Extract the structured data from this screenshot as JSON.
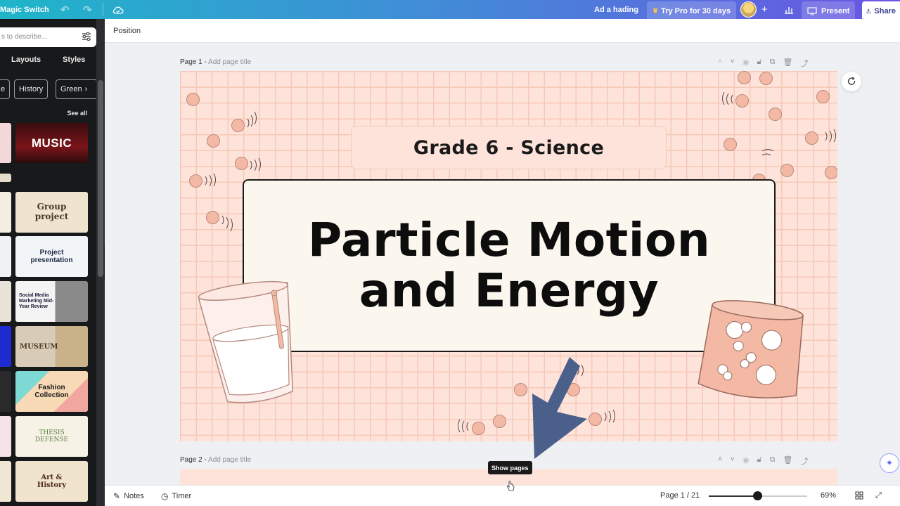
{
  "topbar": {
    "brand": "Magic Switch",
    "add_heading": "Ad a hading",
    "try_pro": "Try Pro for 30 days",
    "present": "Present",
    "share": "Share"
  },
  "left_panel": {
    "search_placeholder": "s to describe...",
    "tabs": [
      "Layouts",
      "Styles"
    ],
    "chips": [
      "e",
      "History",
      "Green"
    ],
    "see_all": "See all",
    "templates": [
      {
        "label": "MUSIC"
      },
      {
        "label": "Group project"
      },
      {
        "label": "Project presentation"
      },
      {
        "label": "Social Media Marketing Mid-Year Review"
      },
      {
        "label": "MUSEUM"
      },
      {
        "label": "Fashion Collection"
      },
      {
        "label": "THESIS DEFENSE"
      },
      {
        "label": "Art & History"
      }
    ]
  },
  "context_bar": {
    "position": "Position"
  },
  "page1": {
    "label": "Page 1 - ",
    "subtitle": "Add page title"
  },
  "page2": {
    "label": "Page 2 - ",
    "subtitle": "Add page title"
  },
  "slide": {
    "grade": "Grade 6 - Science",
    "title_line1": "Particle Motion",
    "title_line2": "and Energy"
  },
  "tooltip": "Show pages",
  "bottombar": {
    "notes": "Notes",
    "timer": "Timer",
    "page_count": "Page 1 / 21",
    "zoom": "69%"
  },
  "colors": {
    "slide_bg": "#fde3da",
    "grid": "#f6c8b8",
    "arrow": "#4a5f8a",
    "panel_bg": "#18191b"
  }
}
